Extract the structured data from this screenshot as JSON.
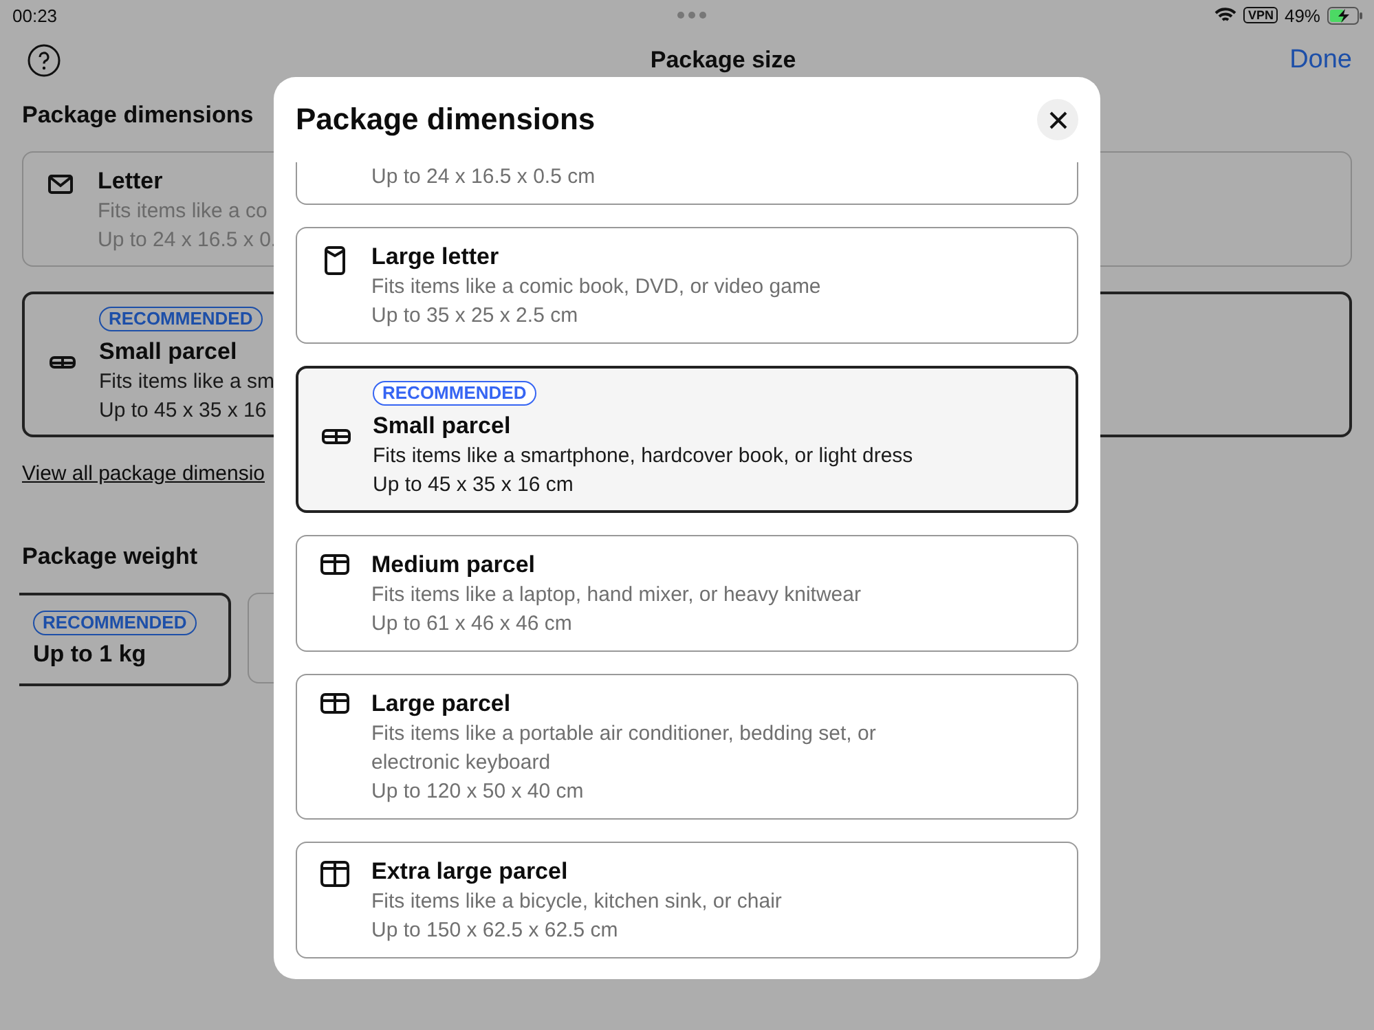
{
  "status_bar": {
    "time": "00:23",
    "vpn": "VPN",
    "battery": "49%"
  },
  "nav": {
    "title": "Package size",
    "done": "Done"
  },
  "background": {
    "dimensions_heading": "Package dimensions",
    "cards": [
      {
        "kind": "letter",
        "title": "Letter",
        "desc": "Fits items like a co",
        "dims": "Up to 24 x 16.5 x 0.",
        "selected": false
      },
      {
        "kind": "small",
        "badge": "RECOMMENDED",
        "title": "Small parcel",
        "desc": "Fits items like a sm",
        "dims": "Up to 45 x 35 x 16",
        "selected": true
      }
    ],
    "view_all": "View all package dimensio",
    "weight_heading": "Package weight",
    "weights": [
      {
        "badge": "RECOMMENDED",
        "label": "Up to 1 kg",
        "selected": true
      },
      {
        "selected": false
      }
    ]
  },
  "modal": {
    "title": "Package dimensions",
    "options": [
      {
        "dims": "Up to 24 x 16.5 x 0.5 cm",
        "selected": false
      },
      {
        "kind": "large_letter",
        "title": "Large letter",
        "desc": "Fits items like a comic book, DVD, or video game",
        "dims": "Up to 35 x 25 x 2.5 cm",
        "selected": false
      },
      {
        "kind": "small",
        "badge": "RECOMMENDED",
        "title": "Small parcel",
        "desc": "Fits items like a smartphone, hardcover book, or light dress",
        "dims": "Up to 45 x 35 x 16 cm",
        "selected": true
      },
      {
        "kind": "medium",
        "title": "Medium parcel",
        "desc": "Fits items like a laptop, hand mixer, or heavy knitwear",
        "dims": "Up to 61 x 46 x 46 cm",
        "selected": false
      },
      {
        "kind": "large",
        "title": "Large parcel",
        "desc": "Fits items like a portable air conditioner, bedding set, or electronic keyboard",
        "dims": "Up to 120 x 50 x 40 cm",
        "selected": false
      },
      {
        "kind": "xlarge",
        "title": "Extra large parcel",
        "desc": "Fits items like a bicycle, kitchen sink, or chair",
        "dims": "Up to 150 x 62.5 x 62.5 cm",
        "selected": false
      }
    ]
  }
}
